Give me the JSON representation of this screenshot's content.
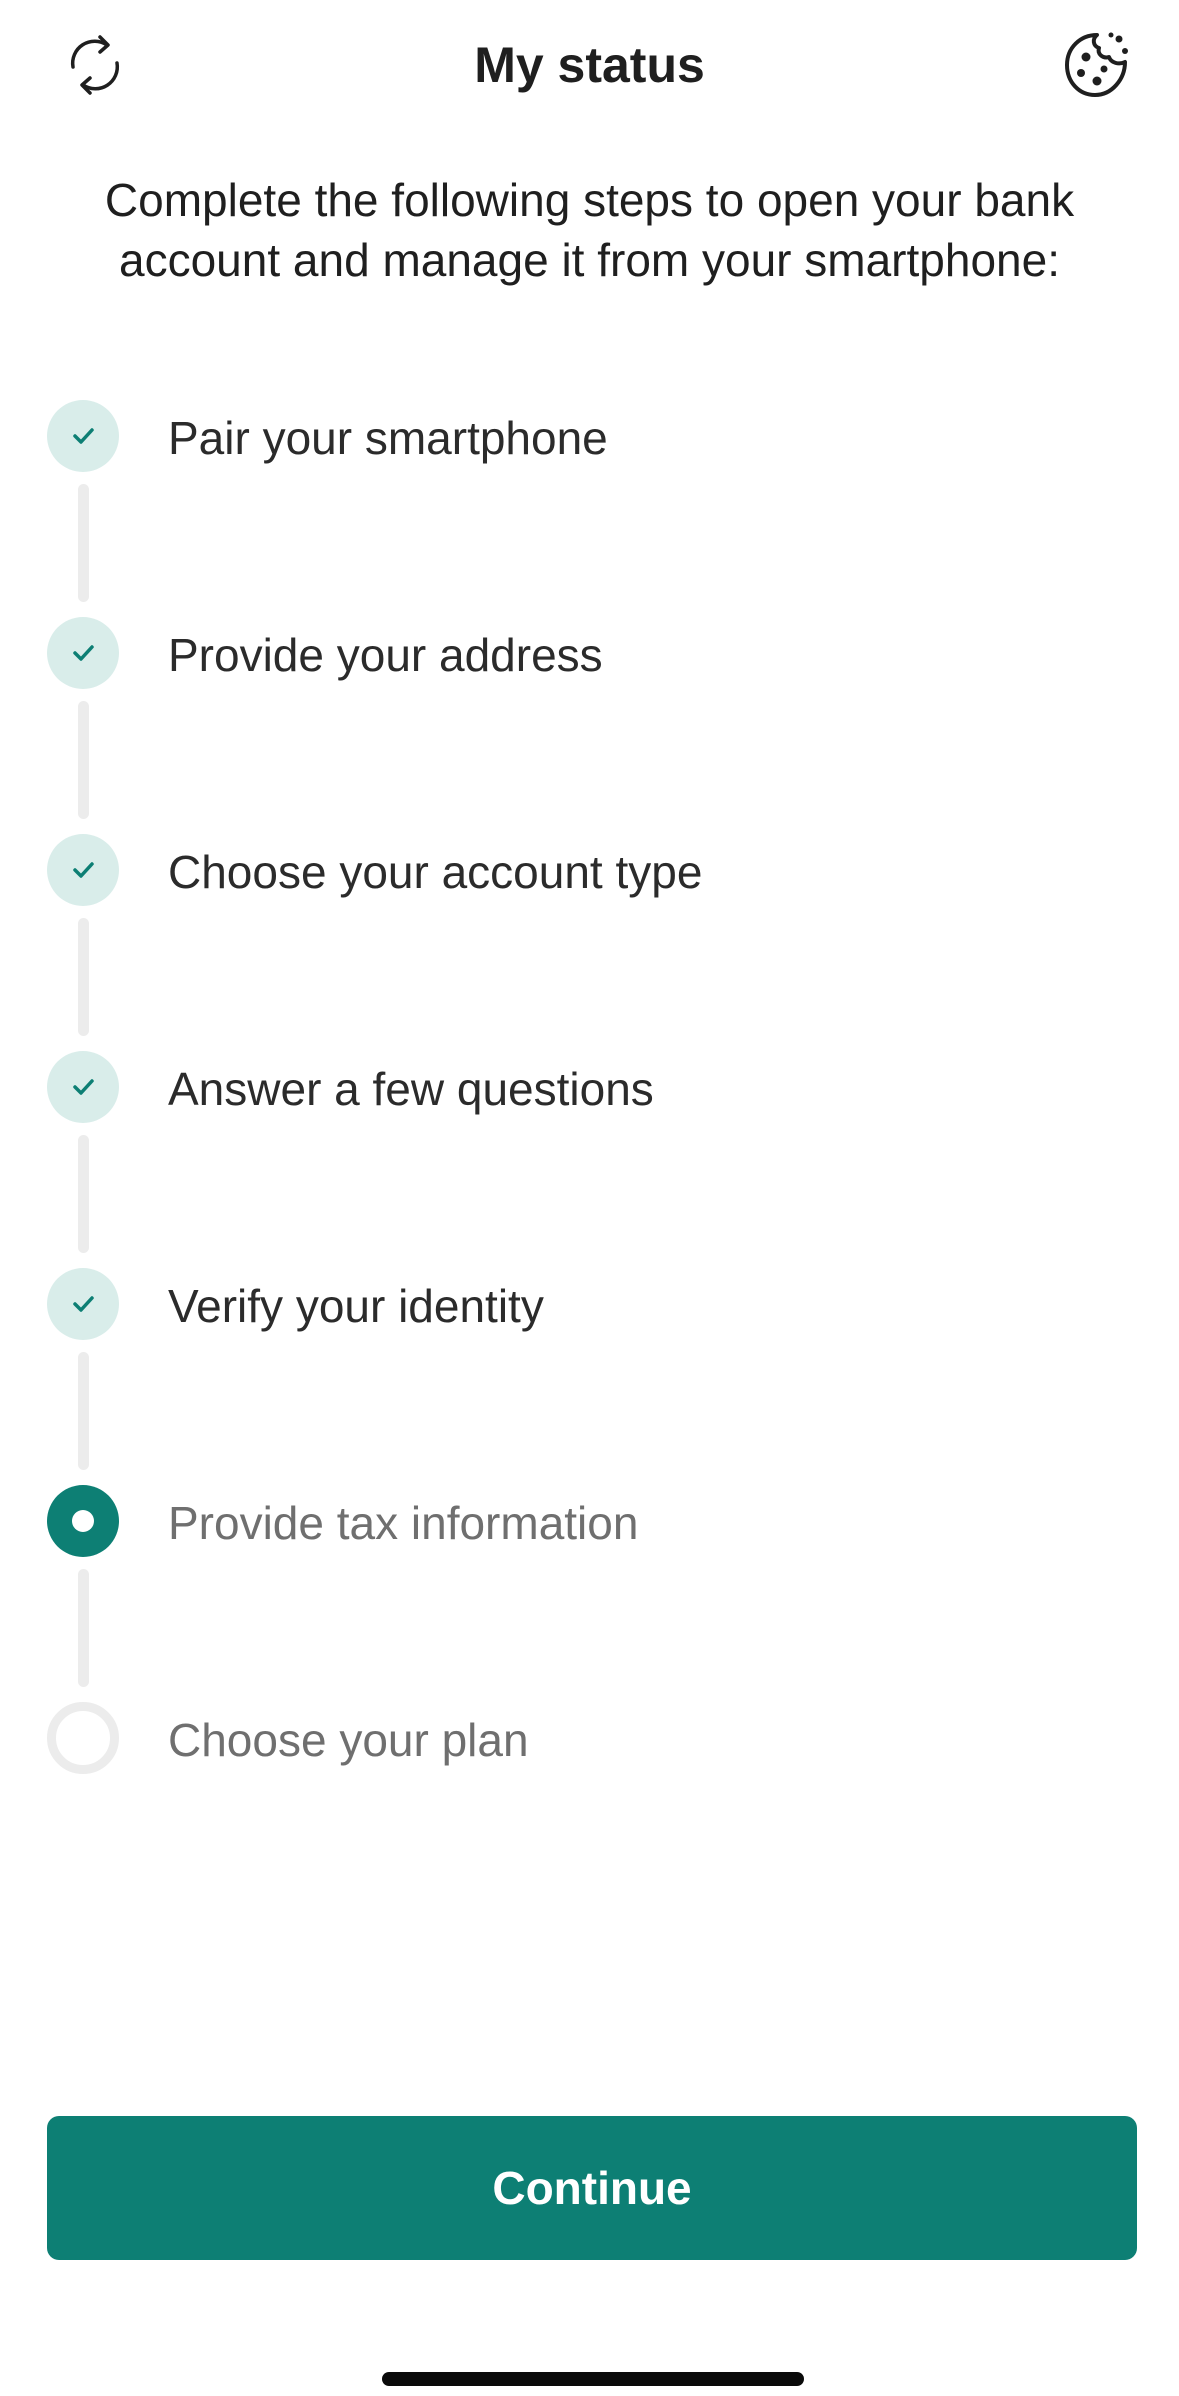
{
  "header": {
    "title": "My status",
    "left_icon": "refresh-icon",
    "right_icon": "cookie-icon"
  },
  "intro": {
    "text": "Complete the following steps to open your bank account and manage it from your smartphone:"
  },
  "steps": [
    {
      "label": "Pair your smartphone",
      "status": "completed"
    },
    {
      "label": "Provide your address",
      "status": "completed"
    },
    {
      "label": "Choose your account type",
      "status": "completed"
    },
    {
      "label": "Answer a few questions",
      "status": "completed"
    },
    {
      "label": "Verify your identity",
      "status": "completed"
    },
    {
      "label": "Provide tax information",
      "status": "current"
    },
    {
      "label": "Choose your plan",
      "status": "pending"
    }
  ],
  "actions": {
    "continue_label": "Continue"
  },
  "colors": {
    "accent": "#0d7f74",
    "completed_bg": "#d9edea",
    "connector": "#ececec"
  }
}
